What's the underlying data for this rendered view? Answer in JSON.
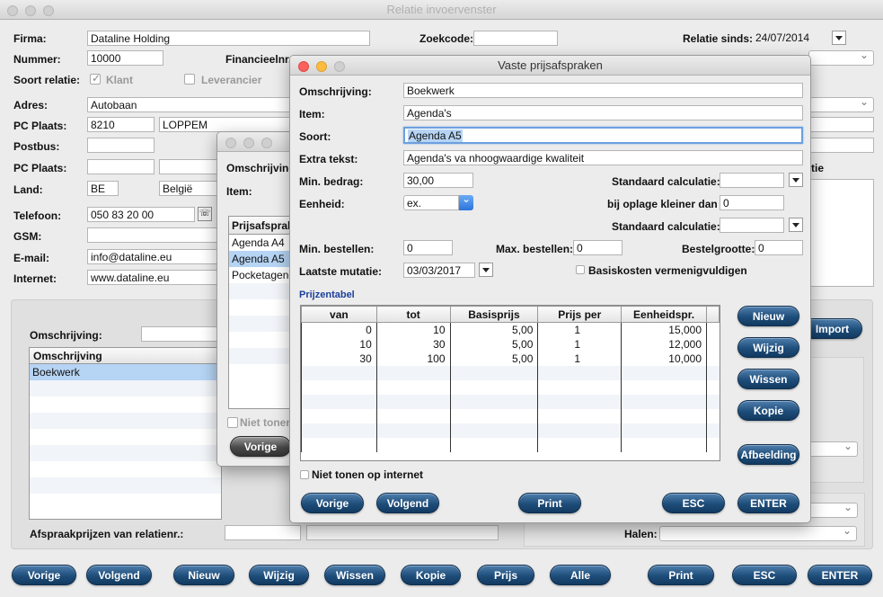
{
  "main": {
    "title": "Relatie invoervenster",
    "labels": {
      "firma": "Firma:",
      "nummer": "Nummer:",
      "soort_relatie": "Soort relatie:",
      "adres": "Adres:",
      "pc_plaats": "PC Plaats:",
      "postbus": "Postbus:",
      "pc_plaats2": "PC Plaats:",
      "land": "Land:",
      "telefoon": "Telefoon:",
      "gsm": "GSM:",
      "email": "E-mail:",
      "internet": "Internet:",
      "zoekcode": "Zoekcode:",
      "financieelnr": "Financieelnr.",
      "relatie_sinds": "Relatie sinds:",
      "klant": "Klant",
      "leverancier": "Leverancier",
      "omschrijving": "Omschrijving:",
      "afspraakprijzen": "Afspraakprijzen van relatienr.:",
      "halen": "Halen:",
      "tie": "tie"
    },
    "values": {
      "firma": "Dataline Holding",
      "nummer": "10000",
      "adres": "Autobaan",
      "postcode": "8210",
      "plaats": "LOPPEM",
      "land_code": "BE",
      "land": "België",
      "telefoon": "050 83 20 00",
      "email": "info@dataline.eu",
      "internet": "www.dataline.eu",
      "relatie_sinds": "24/07/2014"
    },
    "list_header": "Omschrijving",
    "list_rows": [
      "Boekwerk"
    ],
    "import_label": "Import",
    "bottom_buttons": [
      "Vorige",
      "Volgend",
      "Nieuw",
      "Wijzig",
      "Wissen",
      "Kopie",
      "Prijs",
      "Alle",
      "Print",
      "ESC",
      "ENTER"
    ]
  },
  "middle": {
    "labels": {
      "omschrijving": "Omschrijving:",
      "item": "Item:",
      "niet_tonen": "Niet tonen"
    },
    "list_header": "Prijsafspraken",
    "rows": [
      "Agenda A4",
      "Agenda A5",
      "Pocketagenda"
    ],
    "vorige": "Vorige"
  },
  "dialog": {
    "title": "Vaste prijsafspraken",
    "labels": {
      "omschrijving": "Omschrijving:",
      "item": "Item:",
      "soort": "Soort:",
      "extra_tekst": "Extra tekst:",
      "min_bedrag": "Min. bedrag:",
      "eenheid": "Eenheid:",
      "min_bestellen": "Min. bestellen:",
      "laatste_mutatie": "Laatste mutatie:",
      "standaard_calc1": "Standaard calculatie:",
      "bij_oplage": "bij oplage kleiner dan",
      "standaard_calc2": "Standaard calculatie:",
      "max_bestellen": "Max. bestellen:",
      "bestelgrootte": "Bestelgrootte:",
      "basiskosten": "Basiskosten vermenigvuldigen",
      "prijzentabel": "Prijzentabel",
      "niet_tonen": "Niet tonen op internet"
    },
    "values": {
      "omschrijving": "Boekwerk",
      "item": "Agenda's",
      "soort": "Agenda A5",
      "extra_tekst": "Agenda's va nhoogwaardige kwaliteit",
      "min_bedrag": "30,00",
      "eenheid": "ex.",
      "min_bestellen": "0",
      "laatste_mutatie": "03/03/2017",
      "bij_oplage": "0",
      "max_bestellen": "0",
      "bestelgrootte": "0"
    },
    "table": {
      "headers": [
        "van",
        "tot",
        "Basisprijs",
        "Prijs per",
        "Eenheidspr."
      ],
      "rows": [
        [
          "0",
          "10",
          "5,00",
          "1",
          "15,000"
        ],
        [
          "10",
          "30",
          "5,00",
          "1",
          "12,000"
        ],
        [
          "30",
          "100",
          "5,00",
          "1",
          "10,000"
        ]
      ]
    },
    "side_buttons": [
      "Nieuw",
      "Wijzig",
      "Wissen",
      "Kopie",
      "Afbeelding"
    ],
    "bottom_buttons": [
      "Vorige",
      "Volgend",
      "Print",
      "ESC",
      "ENTER"
    ]
  }
}
